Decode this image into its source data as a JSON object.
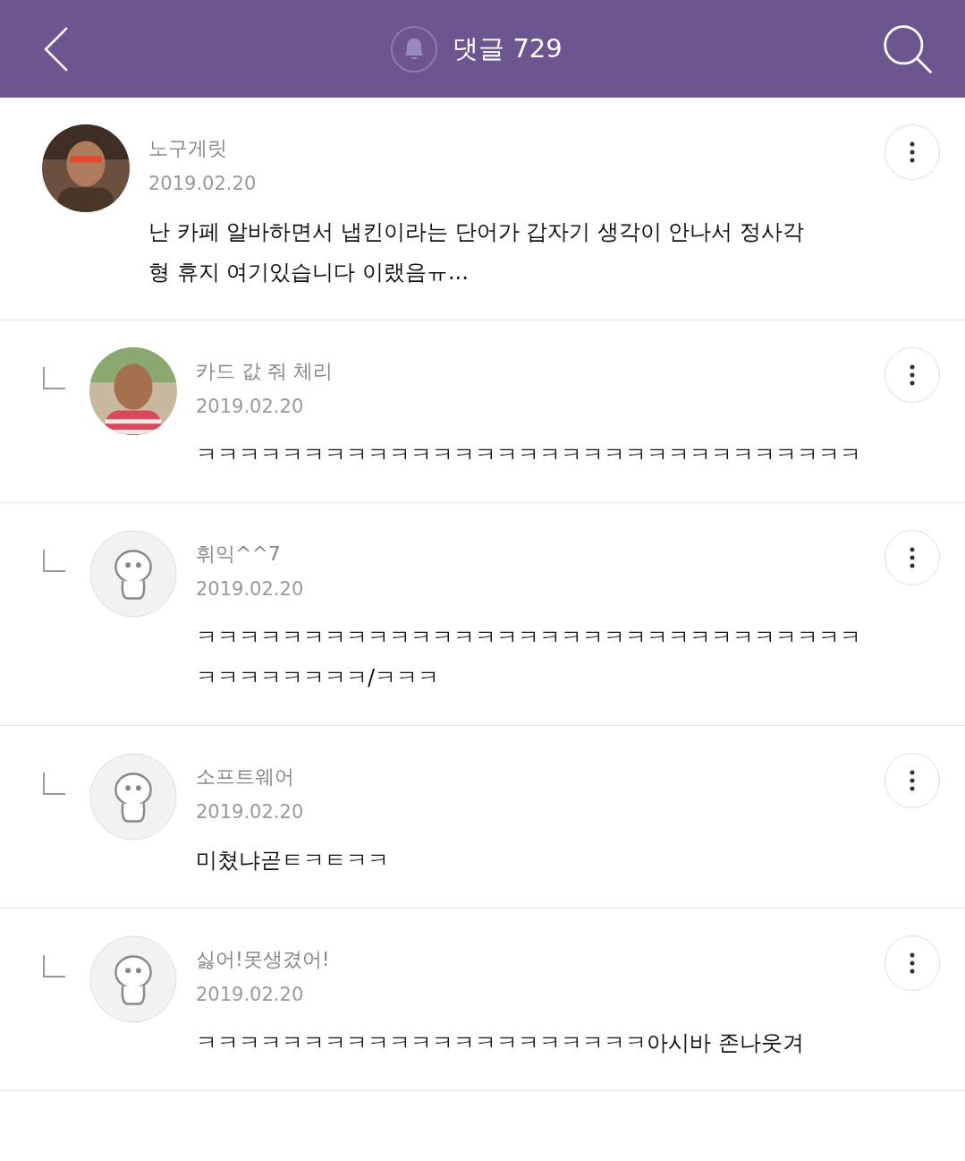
{
  "header": {
    "title": "댓글 729"
  },
  "comments": [
    {
      "kind": "comment",
      "author": "노구게릿",
      "date": "2019.02.20",
      "text": "난 카페 알바하면서 냅킨이라는 단어가 갑자기 생각이 안나서 정사각형 휴지 여기있습니다 이랬음ㅠ..."
    },
    {
      "kind": "reply",
      "author": "카드 값 줘 체리",
      "date": "2019.02.20",
      "text": "ㅋㅋㅋㅋㅋㅋㅋㅋㅋㅋㅋㅋㅋㅋㅋㅋㅋㅋㅋㅋㅋㅋㅋㅋㅋㅋㅋㅋㅋㅋㅋ"
    },
    {
      "kind": "reply",
      "avatar": {
        "kind": "icon"
      },
      "author": "휘익^^7",
      "date": "2019.02.20",
      "text": "ㅋㅋㅋㅋㅋㅋㅋㅋㅋㅋㅋㅋㅋㅋㅋㅋㅋㅋㅋㅋㅋㅋㅋㅋㅋㅋㅋㅋㅋㅋㅋㅋㅋㅋㅋㅋㅋㅋㅋ/ㅋㅋㅋ"
    },
    {
      "kind": "reply",
      "avatar": {
        "kind": "icon"
      },
      "author": "소프트웨어",
      "date": "2019.02.20",
      "text": "미쳤냐곧ㅌㅋㅌㅋㅋ"
    },
    {
      "kind": "reply",
      "avatar": {
        "kind": "icon"
      },
      "author": "싫어!못생겼어!",
      "date": "2019.02.20",
      "text": "ㅋㅋㅋㅋㅋㅋㅋㅋㅋㅋㅋㅋㅋㅋㅋㅋㅋㅋㅋㅋㅋ아시바 존나웃겨"
    }
  ]
}
